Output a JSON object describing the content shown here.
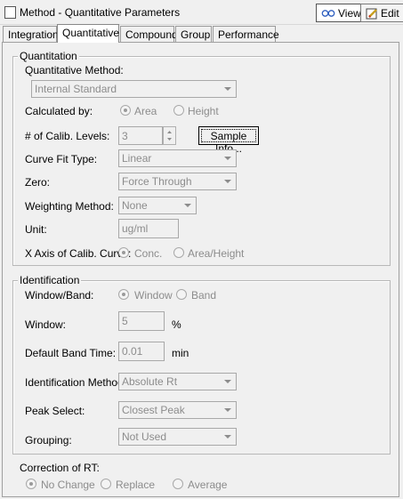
{
  "window": {
    "title": "Method - Quantitative Parameters",
    "view_label": "View",
    "edit_label": "Edit"
  },
  "tabs": [
    "Integration",
    "Quantitative",
    "Compound",
    "Group",
    "Performance"
  ],
  "active_tab": "Quantitative",
  "quantitation": {
    "group_label": "Quantitation",
    "method_label": "Quantitative Method:",
    "method_value": "Internal Standard",
    "calculated_by_label": "Calculated by:",
    "calculated_by_options": [
      "Area",
      "Height"
    ],
    "calculated_by_selected": "Area",
    "calib_levels_label": "# of Calib. Levels:",
    "calib_levels_value": "3",
    "sample_info_button": "Sample Info...",
    "curve_fit_label": "Curve Fit Type:",
    "curve_fit_value": "Linear",
    "zero_label": "Zero:",
    "zero_value": "Force Through",
    "weighting_label": "Weighting Method:",
    "weighting_value": "None",
    "unit_label": "Unit:",
    "unit_value": "ug/ml",
    "x_axis_label": "X Axis of Calib. Curve:",
    "x_axis_options": [
      "Conc.",
      "Area/Height"
    ],
    "x_axis_selected": "Conc."
  },
  "identification": {
    "group_label": "Identification",
    "window_band_label": "Window/Band:",
    "window_band_options": [
      "Window",
      "Band"
    ],
    "window_band_selected": "Window",
    "window_label": "Window:",
    "window_value": "5",
    "window_unit": "%",
    "band_time_label": "Default Band Time:",
    "band_time_value": "0.01",
    "band_time_unit": "min",
    "id_method_label": "Identification Method:",
    "id_method_value": "Absolute Rt",
    "peak_select_label": "Peak Select:",
    "peak_select_value": "Closest Peak",
    "grouping_label": "Grouping:",
    "grouping_value": "Not Used"
  },
  "correction": {
    "label": "Correction of RT:",
    "options": [
      "No Change",
      "Replace",
      "Average"
    ],
    "selected": "No Change"
  }
}
